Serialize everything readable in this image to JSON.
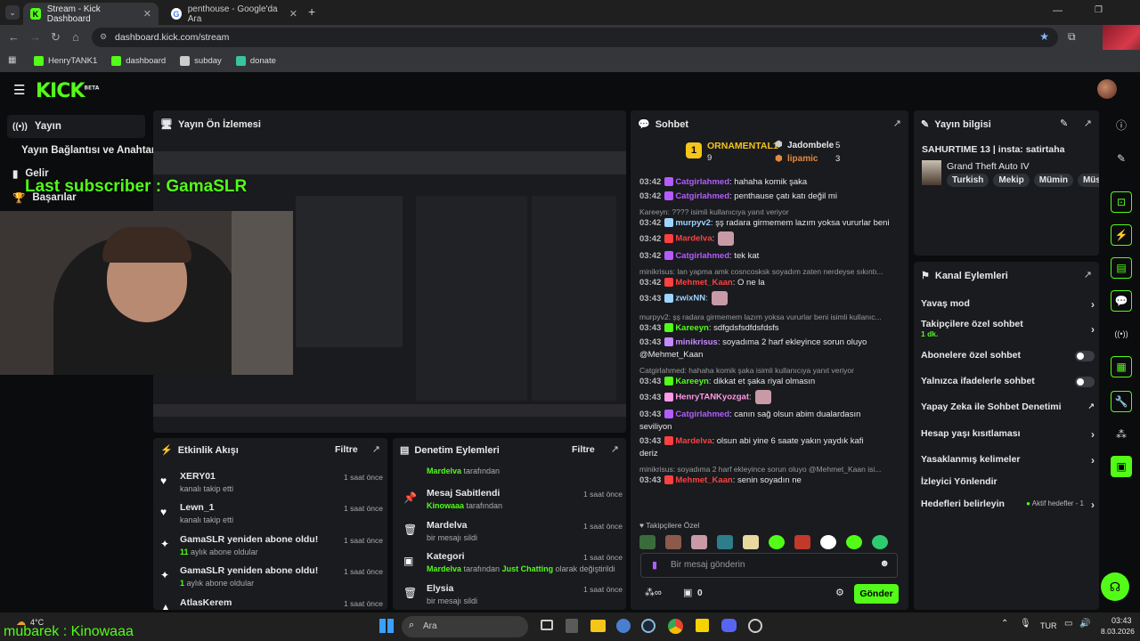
{
  "browser": {
    "tabs": [
      {
        "title": "Stream - Kick Dashboard",
        "active": true
      },
      {
        "title": "penthouse - Google'da Ara",
        "active": false
      }
    ],
    "url": "dashboard.kick.com/stream",
    "bookmarks": [
      "HenryTANK1",
      "dashboard",
      "subday",
      "donate"
    ]
  },
  "kick": {
    "logo": "KICK",
    "logo_sup": "BETA"
  },
  "sidebar": {
    "items": [
      {
        "icon": "broadcast-icon",
        "label": "Yayın"
      },
      {
        "icon": "",
        "label": "Yayın Bağlantısı ve Anahtarı"
      },
      {
        "icon": "chart-icon",
        "label": "Gelir"
      },
      {
        "icon": "trophy-icon",
        "label": "Başarılar"
      }
    ]
  },
  "preview": {
    "title": "Yayın Ön İzlemesi"
  },
  "overlay": {
    "last_subscriber": "Last subscriber : GamaSLR",
    "bottom_text": "mubarek : Kinowaaa"
  },
  "activity": {
    "title": "Etkinlik Akışı",
    "filter": "Filtre",
    "items": [
      {
        "icon": "heart-icon",
        "title": "XERY01",
        "sub": "kanalı takip etti",
        "sub_accent": "",
        "time": "1 saat önce"
      },
      {
        "icon": "heart-icon",
        "title": "Lewn_1",
        "sub": "kanalı takip etti",
        "sub_accent": "",
        "time": "1 saat önce"
      },
      {
        "icon": "sparkle-icon",
        "title": "GamaSLR yeniden abone oldu!",
        "sub": " aylık abone oldular",
        "sub_accent": "11",
        "time": "1 saat önce"
      },
      {
        "icon": "sparkle-icon",
        "title": "GamaSLR yeniden abone oldu!",
        "sub": " aylık abone oldular",
        "sub_accent": "1",
        "time": "1 saat önce"
      },
      {
        "icon": "hat-icon",
        "title": "AtlasKerem",
        "sub": "",
        "sub_accent": "",
        "time": "1 saat önce"
      }
    ]
  },
  "moderation": {
    "title": "Denetim Eylemleri",
    "filter": "Filtre",
    "items": [
      {
        "icon": "",
        "title": "",
        "actor": "Mardelva",
        "rest": " tarafından",
        "time": ""
      },
      {
        "icon": "pin-icon",
        "title": "Mesaj Sabitlendi",
        "actor": "Kinowaaa",
        "rest": " tarafından",
        "time": "1 saat önce"
      },
      {
        "icon": "trash-icon",
        "title": "Mardelva",
        "actor": "",
        "rest": "bir mesajı sildi",
        "time": "1 saat önce"
      },
      {
        "icon": "category-icon",
        "title": "Kategori",
        "actor": "Mardelva",
        "rest": " tarafından ",
        "extra": "Just Chatting",
        "rest2": " olarak değiştirildi",
        "time": "1 saat önce"
      },
      {
        "icon": "trash-icon",
        "title": "Elysia",
        "actor": "",
        "rest": "bir mesajı sildi",
        "time": "1 saat önce"
      }
    ]
  },
  "chat": {
    "title": "Sohbet",
    "leaderboard": {
      "first_name": "ORNAMENTAL1",
      "first_count": "9",
      "second_name": "Jadombele",
      "second_count": "5",
      "third_name": "lipamic",
      "third_count": "3"
    },
    "lines": [
      {
        "type": "msg",
        "time": "03:42",
        "user": "Catgirlahmed",
        "color": "#b45cff",
        "text": ": hahaha komik şaka"
      },
      {
        "type": "msg",
        "time": "03:42",
        "user": "Catgirlahmed",
        "color": "#b45cff",
        "text": ": penthause çatı katı değil mi"
      },
      {
        "type": "reply",
        "text": "Kareeyn: ???? isimli kullanıcıya yanıt veriyor"
      },
      {
        "type": "msg",
        "time": "03:42",
        "user": "murpyv2",
        "color": "#9fd4ff",
        "text": ": şş radara girmemem lazım yoksa vururlar beni"
      },
      {
        "type": "msg",
        "time": "03:42",
        "user": "Mardelva",
        "color": "#ff4040",
        "text": ":"
      },
      {
        "type": "msg",
        "time": "03:42",
        "user": "Catgirlahmed",
        "color": "#b45cff",
        "text": ": tek kat"
      },
      {
        "type": "reply",
        "text": "minikrisus: lan yapma amk cosncosksk soyadım zaten nerdeyse sıkıntı..."
      },
      {
        "type": "msg",
        "time": "03:42",
        "user": "Mehmet_Kaan",
        "color": "#ff4040",
        "text": ": O ne la"
      },
      {
        "type": "msg",
        "time": "03:43",
        "user": "zwixNN",
        "color": "#9fd4ff",
        "text": ":"
      },
      {
        "type": "reply",
        "text": "murpyv2: şş radara girmemem lazım yoksa vururlar beni isimli kullanıc..."
      },
      {
        "type": "msg",
        "time": "03:43",
        "user": "Kareeyn",
        "color": "#53fc18",
        "text": ": sdfgdsfsdfdsfdsfs"
      },
      {
        "type": "msg",
        "time": "03:43",
        "user": "minikrisus",
        "color": "#c58aff",
        "text": ": soyadıma 2 harf ekleyince sorun oluyo"
      },
      {
        "type": "cont",
        "text": "@Mehmet_Kaan"
      },
      {
        "type": "reply",
        "text": "Catgirlahmed: hahaha komik şaka isimli kullanıcıya yanıt veriyor"
      },
      {
        "type": "msg",
        "time": "03:43",
        "user": "Kareeyn",
        "color": "#53fc18",
        "text": ": dikkat et şaka riyal olmasın"
      },
      {
        "type": "msg",
        "time": "03:43",
        "user": "HenryTANKyozgat",
        "color": "#ff9ae6",
        "text": ":"
      },
      {
        "type": "msg",
        "time": "03:43",
        "user": "Catgirlahmed",
        "color": "#b45cff",
        "text": ": canın sağ olsun abim dualardasın"
      },
      {
        "type": "cont",
        "text": "seviliyon"
      },
      {
        "type": "msg",
        "time": "03:43",
        "user": "Mardelva",
        "color": "#ff4040",
        "text": ": olsun abi yine 6 saate yakın yaydık kafi"
      },
      {
        "type": "cont",
        "text": "deriz"
      },
      {
        "type": "reply",
        "text": "minikrisus: soyadıma 2 harf ekleyince sorun oluyo @Mehmet_Kaan isi..."
      },
      {
        "type": "msg",
        "time": "03:43",
        "user": "Mehmet_Kaan",
        "color": "#ff4040",
        "text": ": senin soyadın ne"
      }
    ],
    "emote_section": "Takipçilere Özel",
    "input_placeholder": "Bir mesaj gönderin",
    "points": "0",
    "send": "Gönder"
  },
  "stream_info": {
    "title": "Yayın bilgisi",
    "stream_title": "SAHURTIME 13 | insta: satirtaha",
    "category": "Grand Theft Auto IV",
    "tags": [
      "Turkish",
      "Mekip",
      "Mümin",
      "Müs"
    ]
  },
  "channel_actions": {
    "title": "Kanal Eylemleri",
    "items": [
      {
        "label": "Yavaş mod",
        "sub": "",
        "control": "arrow"
      },
      {
        "label": "Takipçilere özel sohbet",
        "sub": "1 dk.",
        "control": "arrow"
      },
      {
        "label": "Abonelere özel sohbet",
        "sub": "",
        "control": "toggle"
      },
      {
        "label": "Yalnızca ifadelerle sohbet",
        "sub": "",
        "control": "toggle"
      },
      {
        "label": "Yapay Zeka ile Sohbet Denetimi",
        "sub": "",
        "control": "external"
      },
      {
        "label": "Hesap yaşı kısıtlaması",
        "sub": "",
        "control": "arrow"
      },
      {
        "label": "Yasaklanmış kelimeler",
        "sub": "",
        "control": "arrow"
      },
      {
        "label": "İzleyici Yönlendir",
        "sub": "",
        "control": "none"
      },
      {
        "label": "Hedefleri belirleyin",
        "sub": "Aktif hedefler - 1",
        "control": "arrow"
      }
    ]
  },
  "taskbar": {
    "weather": "4°C",
    "search": "Ara",
    "lang": "TUR",
    "time": "03:43",
    "date": "8.03.2026"
  },
  "colors": {
    "accent": "#53fc18",
    "panel": "#191b1f",
    "bg": "#0b0c0d"
  }
}
